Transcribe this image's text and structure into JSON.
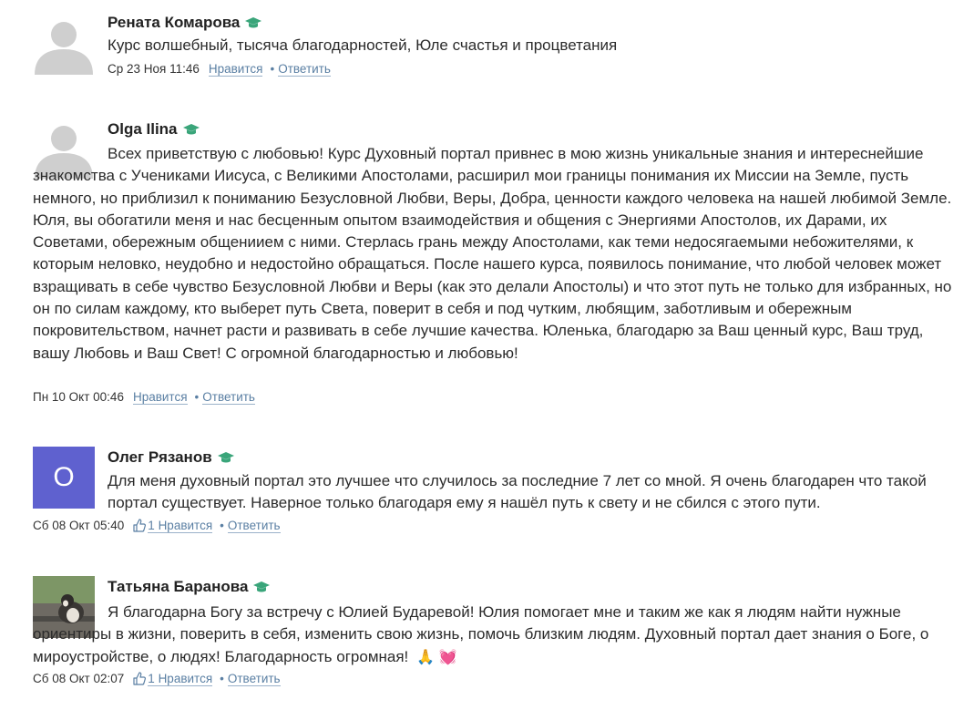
{
  "comments": [
    {
      "author": "Рената Комарова",
      "text": "Курс волшебный, тысяча благодарностей, Юле счастья и процветания",
      "date": "Ср 23 Ноя 11:46",
      "like_label": "Нравится",
      "reply_label": "Ответить",
      "avatar": "placeholder-avatar"
    },
    {
      "author": "Olga Ilina",
      "text": "Всех приветствую с любовью! Курс Духовный портал привнес в мою жизнь уникальные знания и интереснейшие знакомства с Учениками Иисуса, с Великими Апостолами, расширил мои границы понимания их Миссии на Земле, пусть немного, но приблизил к пониманию Безусловной Любви, Веры, Добра, ценности каждого человека на нашей любимой Земле. Юля, вы обогатили меня и нас бесценным опытом взаимодействия и общения с Энергиями Апостолов, их Дарами, их Советами, обережным общениием с ними. Стерлась грань между Апостолами, как теми недосягаемыми небожителями, к которым неловко, неудобно и недостойно обращаться. После нашего курса, появилось понимание, что любой человек может взращивать в себе чувство Безусловной Любви и Веры (как это делали Апостолы) и что этот путь не только для избранных, но он по силам каждому, кто выберет путь Света, поверит в себя и под чутким, любящим, заботливым и обережным покровительством, начнет расти и развивать в себе лучшие качества. Юленька, благодарю за Ваш ценный курс, Ваш труд, вашу Любовь и Ваш Свет! С огромной благодарностью и любовью!",
      "date": "Пн 10 Окт 00:46",
      "like_label": "Нравится",
      "reply_label": "Ответить",
      "avatar": "placeholder-avatar"
    },
    {
      "author": "Олег Рязанов",
      "text": "Для меня духовный портал это лучшее что случилось за последние 7 лет со мной. Я очень благодарен что такой портал существует. Наверное только благодаря ему я нашёл путь к свету и не сбился с этого пути.",
      "date": "Сб 08 Окт 05:40",
      "like_count": "1",
      "like_label": "Нравится",
      "reply_label": "Ответить",
      "avatar_letter": "О",
      "avatar_color": "#5f61cf"
    },
    {
      "author": "Татьяна Баранова",
      "text": "Я благодарна Богу за встречу с Юлией Бударевой! Юлия помогает мне и таким же как я людям найти нужные ориентиры в жизни, поверить в себя, изменить свою жизнь, помочь близким людям. Духовный портал дает знания о Боге, о мироустройстве, о людях! Благодарность огромная!",
      "emojis": [
        "🙏",
        "💓"
      ],
      "date": "Сб 08 Окт 02:07",
      "like_count": "1",
      "like_label": "Нравится",
      "reply_label": "Ответить",
      "avatar": "dog-photo-avatar"
    }
  ],
  "colors": {
    "link": "#5a7fa3",
    "badge": "#3aa57a",
    "avatar_placeholder": "#cfcfcf",
    "avatar_letter_bg": "#5f61cf"
  },
  "icons": {
    "badge": "graduation-cap-icon",
    "like": "thumbs-up-icon"
  }
}
